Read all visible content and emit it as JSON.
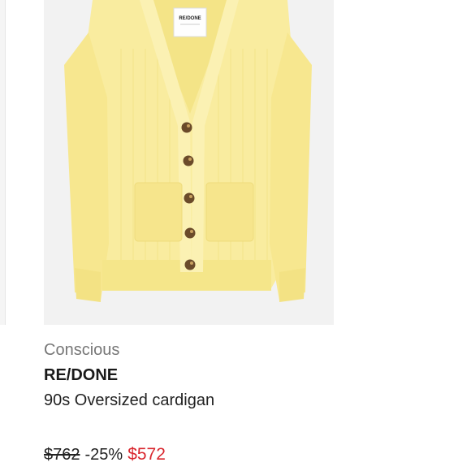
{
  "product": {
    "label": "Conscious",
    "brand": "RE/DONE",
    "name": "90s Oversized cardigan",
    "image": {
      "garment": "yellow-cardigan",
      "garment_color": "#f9ec9f",
      "background_color": "#f2f2f2",
      "tag_text": "RE/DONE"
    },
    "price": {
      "original": "$762",
      "discount": "-25%",
      "current": "$572",
      "sale_color": "#d9252d"
    }
  }
}
